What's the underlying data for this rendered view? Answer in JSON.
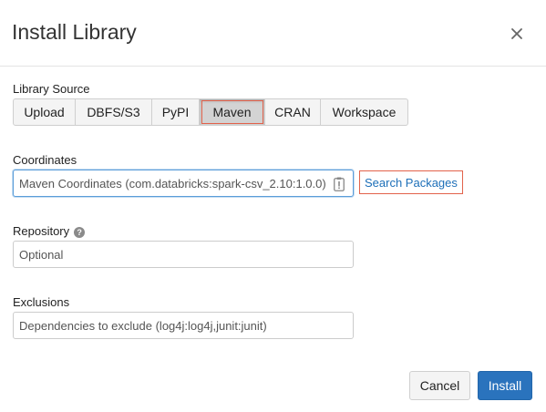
{
  "dialog": {
    "title": "Install Library",
    "close_icon": "close-icon"
  },
  "library_source": {
    "label": "Library Source",
    "options": [
      "Upload",
      "DBFS/S3",
      "PyPI",
      "Maven",
      "CRAN",
      "Workspace"
    ],
    "selected": "Maven"
  },
  "coordinates": {
    "label": "Coordinates",
    "placeholder": "Maven Coordinates (com.databricks:spark-csv_2.10:1.0.0)",
    "value": "",
    "search_link": "Search Packages"
  },
  "repository": {
    "label": "Repository",
    "help_icon": "question-circle-icon",
    "placeholder": "Optional",
    "value": ""
  },
  "exclusions": {
    "label": "Exclusions",
    "placeholder": "Dependencies to exclude (log4j:log4j,junit:junit)",
    "value": ""
  },
  "footer": {
    "cancel_label": "Cancel",
    "install_label": "Install"
  },
  "colors": {
    "primary": "#2a73bd",
    "link": "#1d6fb8",
    "highlight": "#e2624b",
    "focus": "#5b9dd9"
  }
}
